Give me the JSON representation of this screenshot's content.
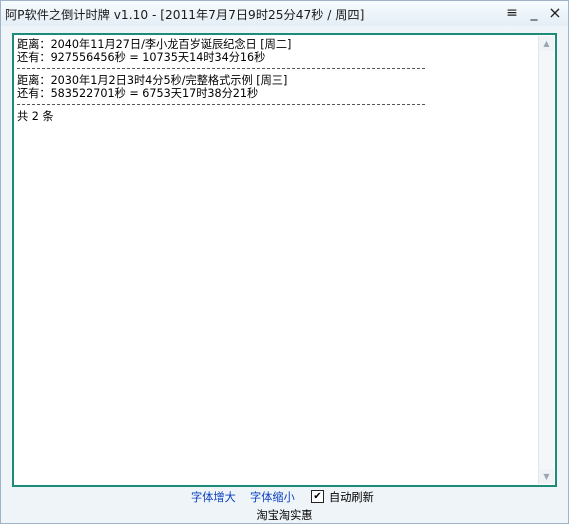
{
  "window": {
    "title": "阿P软件之倒计时牌 v1.10 - [2011年7月7日9时25分47秒 / 周四]"
  },
  "controls": {
    "menu_icon": "menu-lines-icon",
    "minimize_icon": "minimize-icon",
    "close_icon": "close-icon"
  },
  "entries": [
    {
      "line1": "距离：2040年11月27日/李小龙百岁诞辰纪念日 [周二]",
      "line2": "还有：927556456秒 = 10735天14时34分16秒"
    },
    {
      "line1": "距离：2030年1月2日3时4分5秒/完整格式示例 [周三]",
      "line2": "还有：583522701秒 = 6753天17时38分21秒"
    }
  ],
  "summary": "共 2 条",
  "footer": {
    "font_increase": "字体增大",
    "font_decrease": "字体缩小",
    "auto_refresh_label": "自动刷新",
    "auto_refresh_checked": true
  },
  "bottom_link": "淘宝淘实惠",
  "colors": {
    "panel_border": "#1e8a78",
    "link": "#0b3fbf",
    "window_bg": "#eef4f8"
  }
}
